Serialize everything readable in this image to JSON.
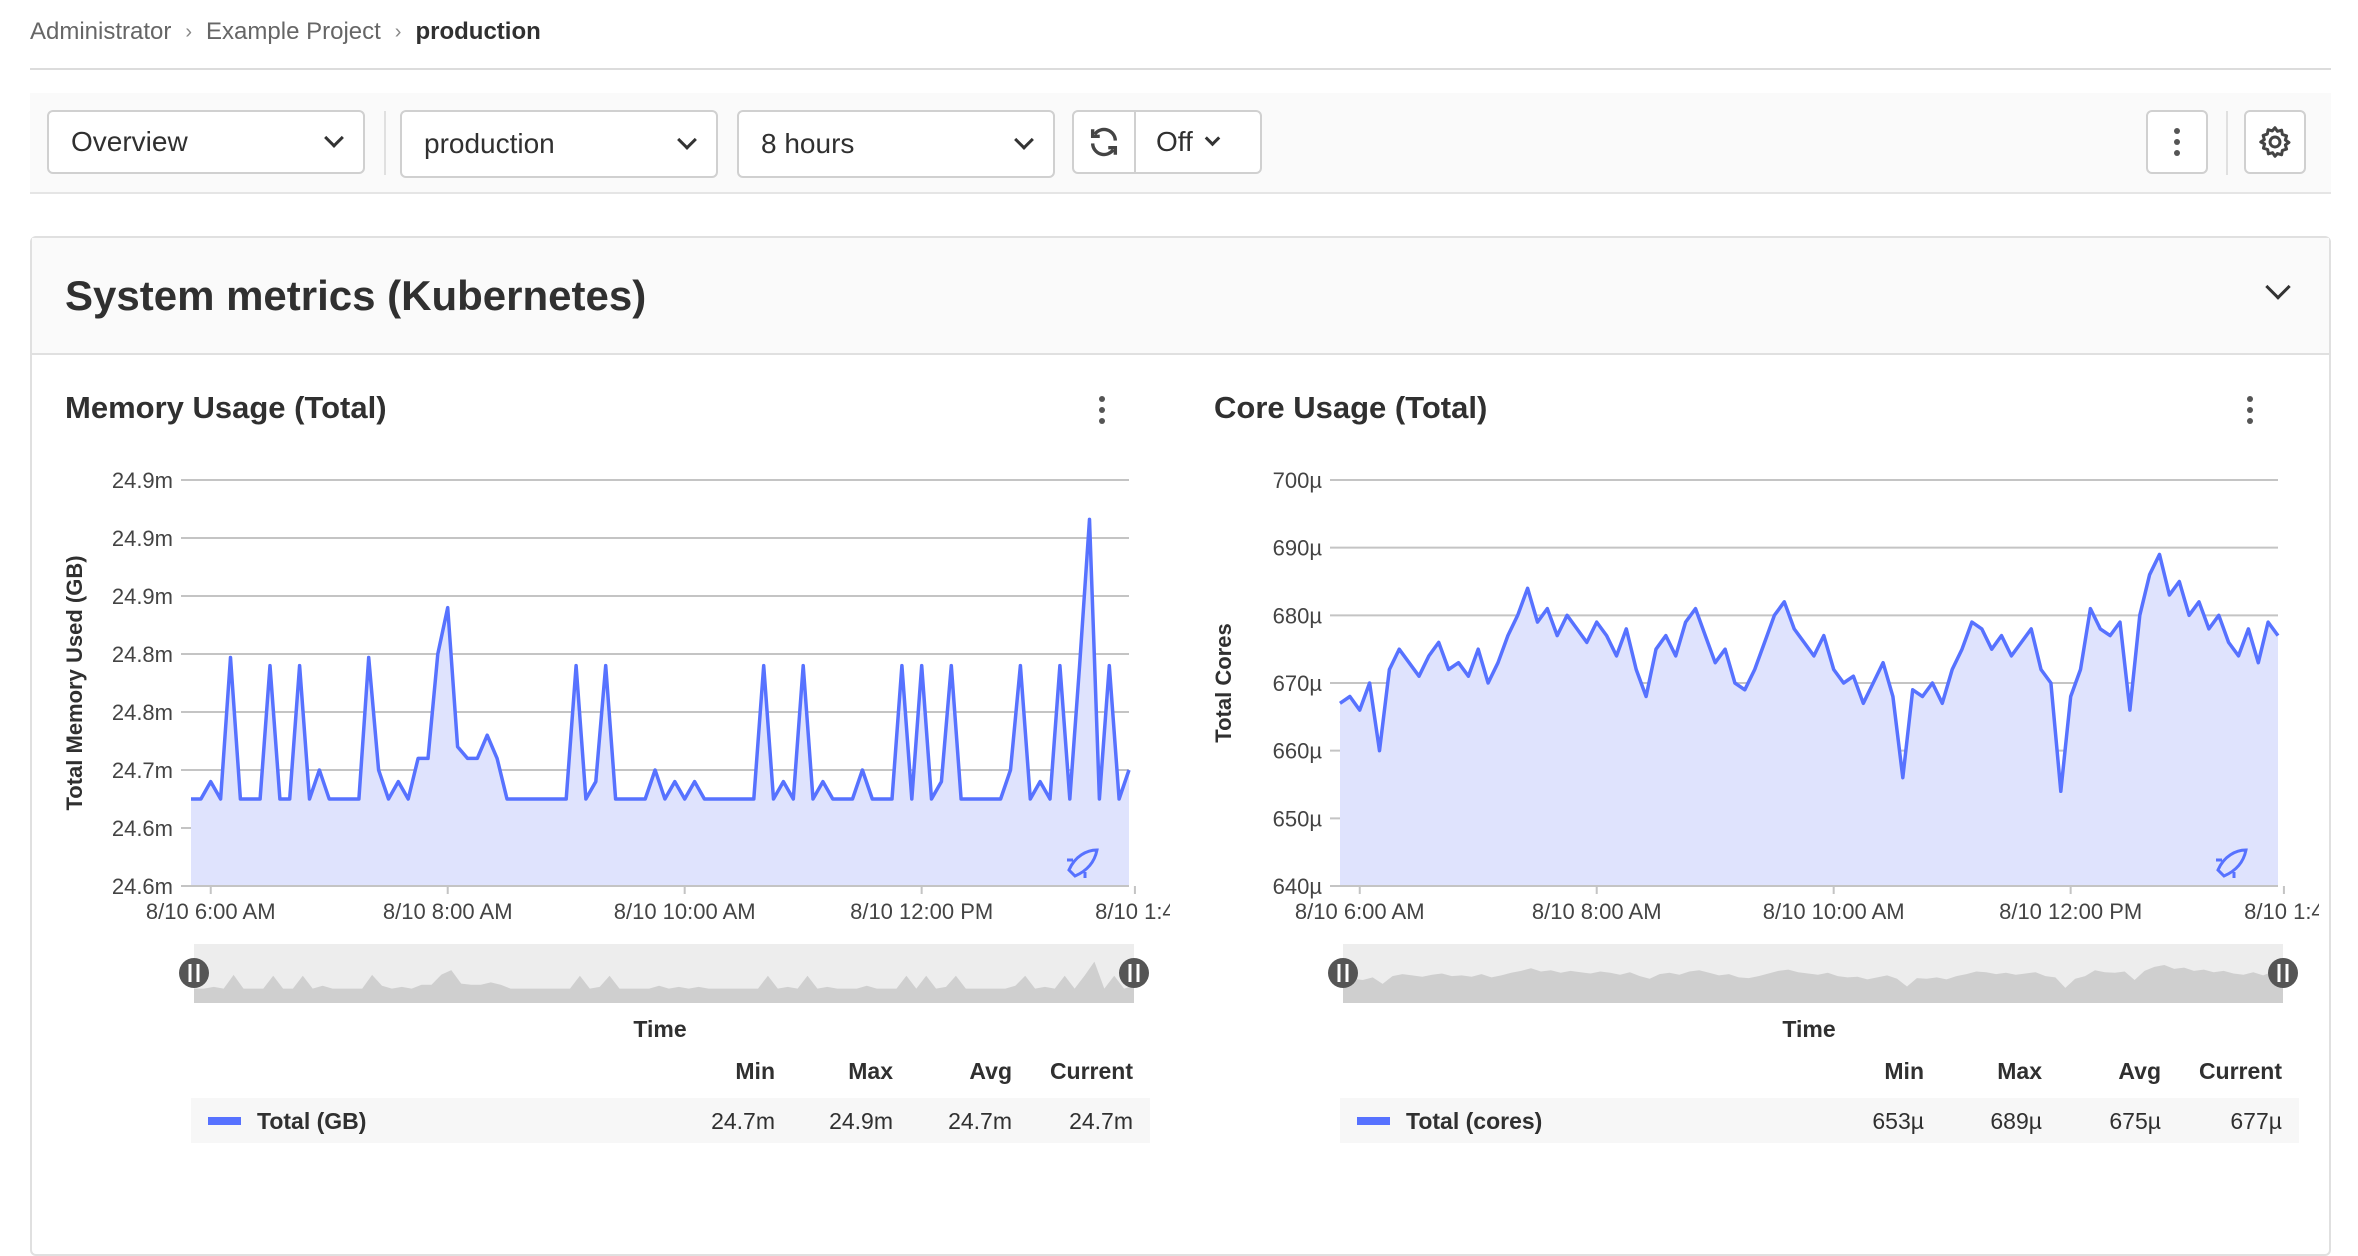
{
  "breadcrumb": [
    "Administrator",
    "Example Project",
    "production"
  ],
  "toolbar": {
    "dashboard": "Overview",
    "environment": "production",
    "time_range": "8 hours",
    "refresh_interval": "Off",
    "icons": [
      "refresh-icon",
      "kebab-icon",
      "gear-icon"
    ]
  },
  "panel": {
    "title": "System metrics (Kubernetes)"
  },
  "colors": {
    "series": "#5772ff",
    "area": "#dfe3fd",
    "grid": "#c4c4c4",
    "overview": "#cfcfcf"
  },
  "chart_data": [
    {
      "type": "area",
      "title": "Memory Usage (Total)",
      "ylabel": "Total Memory Used (GB)",
      "xlabel": "Time",
      "x_range": [
        "8/10 5:50 AM",
        "8/10 1:45 PM"
      ],
      "interval_minutes": 5,
      "x_ticks": [
        "8/10 6:00 AM",
        "8/10 8:00 AM",
        "8/10 10:00 AM",
        "8/10 12:00 PM",
        "8/10 1:4"
      ],
      "x_tick_minutes": [
        10,
        130,
        250,
        370,
        478
      ],
      "y_ticks": [
        "24.6m",
        "24.6m",
        "24.7m",
        "24.8m",
        "24.8m",
        "24.9m",
        "24.9m",
        "24.9m"
      ],
      "ylim": [
        24.6,
        24.95
      ],
      "grid": true,
      "series": [
        {
          "name": "Total (GB)",
          "values": [
            24.675,
            24.675,
            24.69,
            24.675,
            24.797,
            24.675,
            24.675,
            24.675,
            24.79,
            24.675,
            24.675,
            24.79,
            24.675,
            24.7,
            24.675,
            24.675,
            24.675,
            24.675,
            24.797,
            24.7,
            24.675,
            24.69,
            24.675,
            24.71,
            24.71,
            24.8,
            24.84,
            24.72,
            24.71,
            24.71,
            24.73,
            24.71,
            24.675,
            24.675,
            24.675,
            24.675,
            24.675,
            24.675,
            24.675,
            24.79,
            24.675,
            24.69,
            24.79,
            24.675,
            24.675,
            24.675,
            24.675,
            24.7,
            24.675,
            24.69,
            24.675,
            24.69,
            24.675,
            24.675,
            24.675,
            24.675,
            24.675,
            24.675,
            24.79,
            24.675,
            24.69,
            24.675,
            24.79,
            24.675,
            24.69,
            24.675,
            24.675,
            24.675,
            24.7,
            24.675,
            24.675,
            24.675,
            24.79,
            24.675,
            24.79,
            24.675,
            24.69,
            24.79,
            24.675,
            24.675,
            24.675,
            24.675,
            24.675,
            24.7,
            24.79,
            24.675,
            24.69,
            24.675,
            24.79,
            24.675,
            24.79,
            24.916,
            24.675,
            24.79,
            24.675,
            24.7
          ]
        }
      ],
      "legend": {
        "headers": [
          "Min",
          "Max",
          "Avg",
          "Current"
        ],
        "label": "Total (GB)",
        "min": "24.7m",
        "max": "24.9m",
        "avg": "24.7m",
        "current": "24.7m"
      }
    },
    {
      "type": "area",
      "title": "Core Usage (Total)",
      "ylabel": "Total Cores",
      "xlabel": "Time",
      "x_range": [
        "8/10 5:50 AM",
        "8/10 1:45 PM"
      ],
      "interval_minutes": 5,
      "x_ticks": [
        "8/10 6:00 AM",
        "8/10 8:00 AM",
        "8/10 10:00 AM",
        "8/10 12:00 PM",
        "8/10 1:4"
      ],
      "x_tick_minutes": [
        10,
        130,
        250,
        370,
        478
      ],
      "y_ticks": [
        "640µ",
        "650µ",
        "660µ",
        "670µ",
        "680µ",
        "690µ",
        "700µ"
      ],
      "ylim": [
        640,
        700
      ],
      "grid": true,
      "series": [
        {
          "name": "Total (cores)",
          "values": [
            667,
            668,
            666,
            670,
            660,
            672,
            675,
            673,
            671,
            674,
            676,
            672,
            673,
            671,
            675,
            670,
            673,
            677,
            680,
            684,
            679,
            681,
            677,
            680,
            678,
            676,
            679,
            677,
            674,
            678,
            672,
            668,
            675,
            677,
            674,
            679,
            681,
            677,
            673,
            675,
            670,
            669,
            672,
            676,
            680,
            682,
            678,
            676,
            674,
            677,
            672,
            670,
            671,
            667,
            670,
            673,
            668,
            656,
            669,
            668,
            670,
            667,
            672,
            675,
            679,
            678,
            675,
            677,
            674,
            676,
            678,
            672,
            670,
            654,
            668,
            672,
            681,
            678,
            677,
            679,
            666,
            680,
            686,
            689,
            683,
            685,
            680,
            682,
            678,
            680,
            676,
            674,
            678,
            673,
            679,
            677
          ]
        }
      ],
      "legend": {
        "headers": [
          "Min",
          "Max",
          "Avg",
          "Current"
        ],
        "label": "Total (cores)",
        "min": "653µ",
        "max": "689µ",
        "avg": "675µ",
        "current": "677µ"
      }
    }
  ]
}
